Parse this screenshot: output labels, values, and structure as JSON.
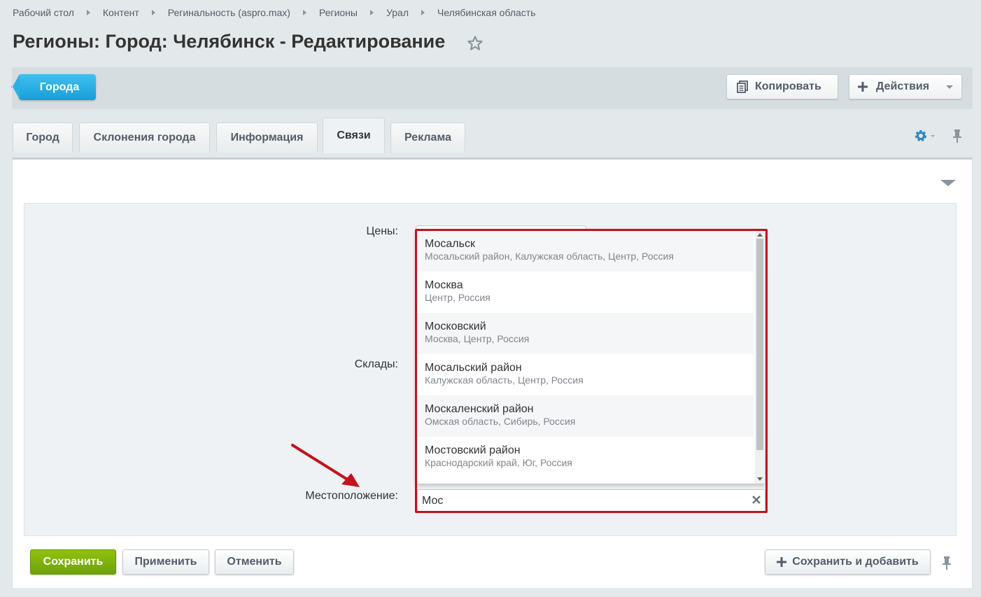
{
  "breadcrumb": [
    "Рабочий стол",
    "Контент",
    "Регинальность (aspro.max)",
    "Регионы",
    "Урал",
    "Челябинская область"
  ],
  "page_title": "Регионы: Город: Челябинск - Редактирование",
  "toolbar": {
    "back_label": "Города",
    "copy_label": "Копировать",
    "actions_label": "Действия"
  },
  "tabs": [
    "Город",
    "Склонения города",
    "Информация",
    "Связи",
    "Реклама"
  ],
  "active_tab": "Связи",
  "form": {
    "prices_label": "Цены:",
    "stores_label": "Склады:",
    "location_label": "Местоположение:",
    "location_value": "Мос"
  },
  "dropdown": [
    {
      "name": "Мосальск",
      "path": "Мосальский район, Калужская область, Центр, Россия"
    },
    {
      "name": "Москва",
      "path": "Центр, Россия"
    },
    {
      "name": "Московский",
      "path": "Москва, Центр, Россия"
    },
    {
      "name": "Мосальский район",
      "path": "Калужская область, Центр, Россия"
    },
    {
      "name": "Москаленский район",
      "path": "Омская область, Сибирь, Россия"
    },
    {
      "name": "Мостовский район",
      "path": "Краснодарский край, Юг, Россия"
    }
  ],
  "buttons": {
    "save": "Сохранить",
    "apply": "Применить",
    "cancel": "Отменить",
    "save_add": "Сохранить и добавить"
  },
  "colors": {
    "accent_blue": "#1a9ed8",
    "save_green": "#6fa20a",
    "highlight_red": "#c4121d"
  }
}
